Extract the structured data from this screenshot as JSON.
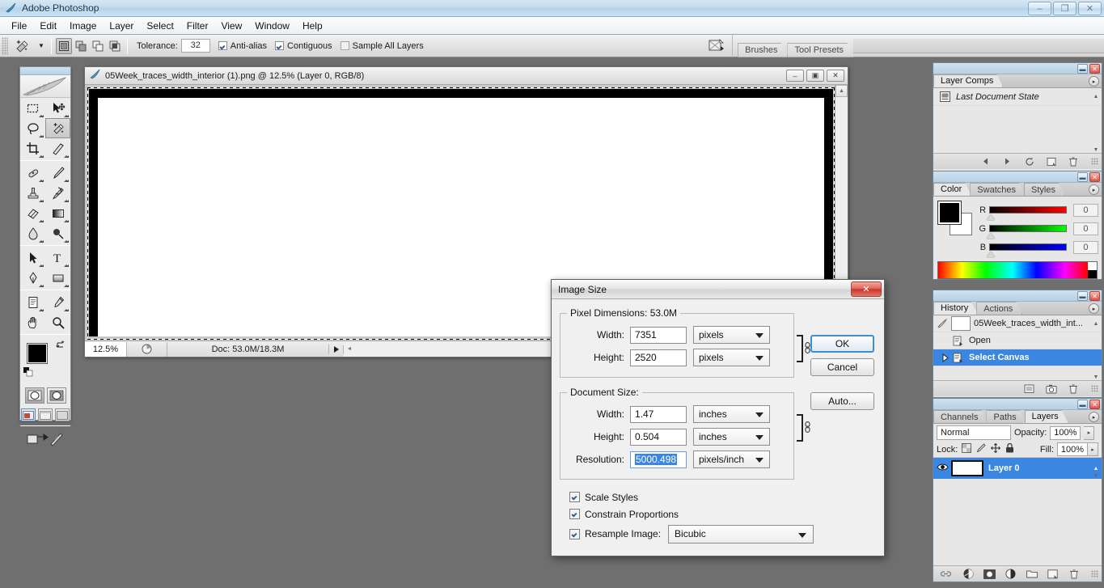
{
  "window": {
    "title": "Adobe Photoshop",
    "icon": "photoshop-feather-icon",
    "buttons": {
      "minimize": "–",
      "restore": "❐",
      "close": "✕"
    }
  },
  "menubar": {
    "items": [
      {
        "label": "File",
        "mnemonic": "F"
      },
      {
        "label": "Edit",
        "mnemonic": "E"
      },
      {
        "label": "Image",
        "mnemonic": "I"
      },
      {
        "label": "Layer",
        "mnemonic": "L"
      },
      {
        "label": "Select",
        "mnemonic": "S"
      },
      {
        "label": "Filter",
        "mnemonic": "t"
      },
      {
        "label": "View",
        "mnemonic": "V"
      },
      {
        "label": "Window",
        "mnemonic": "W"
      },
      {
        "label": "Help",
        "mnemonic": "H"
      }
    ]
  },
  "options_bar": {
    "active_tool": "magic-wand-tool",
    "selection_modes": [
      "new-selection",
      "add-to-selection",
      "subtract-from-selection",
      "intersect-with-selection"
    ],
    "selection_mode_active": 0,
    "tolerance_label": "Tolerance:",
    "tolerance_value": "32",
    "checkboxes": [
      {
        "label": "Anti-alias",
        "checked": true
      },
      {
        "label": "Contiguous",
        "checked": true
      },
      {
        "label": "Sample All Layers",
        "checked": false
      }
    ],
    "dock_tabs": [
      "Brushes",
      "Tool Presets"
    ]
  },
  "toolbox": {
    "tools": [
      "rectangular-marquee-tool",
      "move-tool",
      "lasso-tool",
      "magic-wand-tool",
      "crop-tool",
      "slice-tool",
      "healing-brush-tool",
      "brush-tool",
      "clone-stamp-tool",
      "history-brush-tool",
      "eraser-tool",
      "gradient-tool",
      "blur-tool",
      "dodge-tool",
      "path-selection-tool",
      "type-tool",
      "pen-tool",
      "rectangle-tool",
      "notes-tool",
      "eyedropper-tool",
      "hand-tool",
      "zoom-tool"
    ],
    "selected_tool": "magic-wand-tool",
    "foreground_color": "#000000",
    "background_color": "#ffffff",
    "quick_mask_modes": [
      "standard-mode",
      "quick-mask-mode"
    ],
    "screen_modes": [
      "standard-screen-mode",
      "full-screen-with-menubar",
      "full-screen-mode"
    ],
    "screen_mode_active": 0,
    "jump_to_imageready": "edit-in-imageready-icon"
  },
  "document": {
    "title": "05Week_traces_width_interior (1).png @ 12.5% (Layer 0, RGB/8)",
    "buttons": {
      "minimize": "–",
      "restore": "▣",
      "close": "✕"
    },
    "status": {
      "zoom": "12.5%",
      "doc_info": "Doc: 53.0M/18.3M"
    }
  },
  "panels": {
    "layer_comps": {
      "tabs": [
        {
          "label": "Layer Comps",
          "active": true
        }
      ],
      "rows": [
        {
          "label": "Last Document State",
          "italic": true
        }
      ],
      "footer_icons": [
        "previous-layer-comp-icon",
        "next-layer-comp-icon",
        "update-layer-comp-icon",
        "new-layer-comp-icon",
        "delete-layer-comp-icon"
      ]
    },
    "color": {
      "tabs": [
        {
          "label": "Color",
          "active": true
        },
        {
          "label": "Swatches",
          "active": false
        },
        {
          "label": "Styles",
          "active": false
        }
      ],
      "channels": [
        {
          "label": "R",
          "value": "0",
          "color": "#ff0000"
        },
        {
          "label": "G",
          "value": "0",
          "color": "#00ff00"
        },
        {
          "label": "B",
          "value": "0",
          "color": "#0000ff"
        }
      ],
      "foreground": "#000000",
      "background": "#ffffff"
    },
    "history": {
      "tabs": [
        {
          "label": "History",
          "active": true
        },
        {
          "label": "Actions",
          "active": false
        }
      ],
      "snapshot": "05Week_traces_width_int...",
      "states": [
        {
          "label": "Open",
          "selected": false
        },
        {
          "label": "Select Canvas",
          "selected": true
        }
      ],
      "footer_icons": [
        "new-document-from-state-icon",
        "new-snapshot-icon",
        "delete-state-icon"
      ]
    },
    "layers": {
      "tabs": [
        {
          "label": "Channels",
          "active": false
        },
        {
          "label": "Paths",
          "active": false
        },
        {
          "label": "Layers",
          "active": true
        }
      ],
      "blend_mode": "Normal",
      "opacity_label": "Opacity:",
      "opacity_value": "100%",
      "lock_label": "Lock:",
      "lock_icons": [
        "lock-transparent-pixels-icon",
        "lock-image-pixels-icon",
        "lock-position-icon",
        "lock-all-icon"
      ],
      "fill_label": "Fill:",
      "fill_value": "100%",
      "items": [
        {
          "name": "Layer 0",
          "visible": true,
          "selected": true
        }
      ],
      "footer_icons": [
        "link-layers-icon",
        "layer-style-icon",
        "layer-mask-icon",
        "adjustment-layer-icon",
        "new-group-icon",
        "new-layer-icon",
        "delete-layer-icon"
      ]
    }
  },
  "dialog": {
    "title": "Image Size",
    "close_label": "✕",
    "pixel_dimensions": {
      "legend": "Pixel Dimensions:  53.0M",
      "legend_label": "Pixel Dimensions:",
      "size": "53.0M",
      "width": {
        "label": "Width:",
        "mnemonic": "W",
        "value": "7351",
        "unit": "pixels"
      },
      "height": {
        "label": "Height:",
        "mnemonic": "H",
        "value": "2520",
        "unit": "pixels"
      },
      "chain_linked": true
    },
    "document_size": {
      "legend": "Document Size:",
      "width": {
        "label": "Width:",
        "mnemonic": "W",
        "value": "1.47",
        "unit": "inches"
      },
      "height": {
        "label": "Height:",
        "mnemonic": "H",
        "value": "0.504",
        "unit": "inches"
      },
      "resolution": {
        "label": "Resolution:",
        "mnemonic": "R",
        "value": "5000.498",
        "unit": "pixels/inch",
        "focused": true
      },
      "chain_linked": true
    },
    "checkboxes": [
      {
        "label": "Scale Styles",
        "mnemonic": "",
        "checked": true
      },
      {
        "label": "Constrain Proportions",
        "mnemonic": "C",
        "checked": true
      },
      {
        "label": "Resample Image:",
        "mnemonic": "I",
        "checked": true
      }
    ],
    "resample_method": "Bicubic",
    "buttons": [
      {
        "label": "OK",
        "primary": true
      },
      {
        "label": "Cancel",
        "primary": false
      },
      {
        "label": "Auto...",
        "primary": false,
        "mnemonic": "A"
      }
    ]
  }
}
